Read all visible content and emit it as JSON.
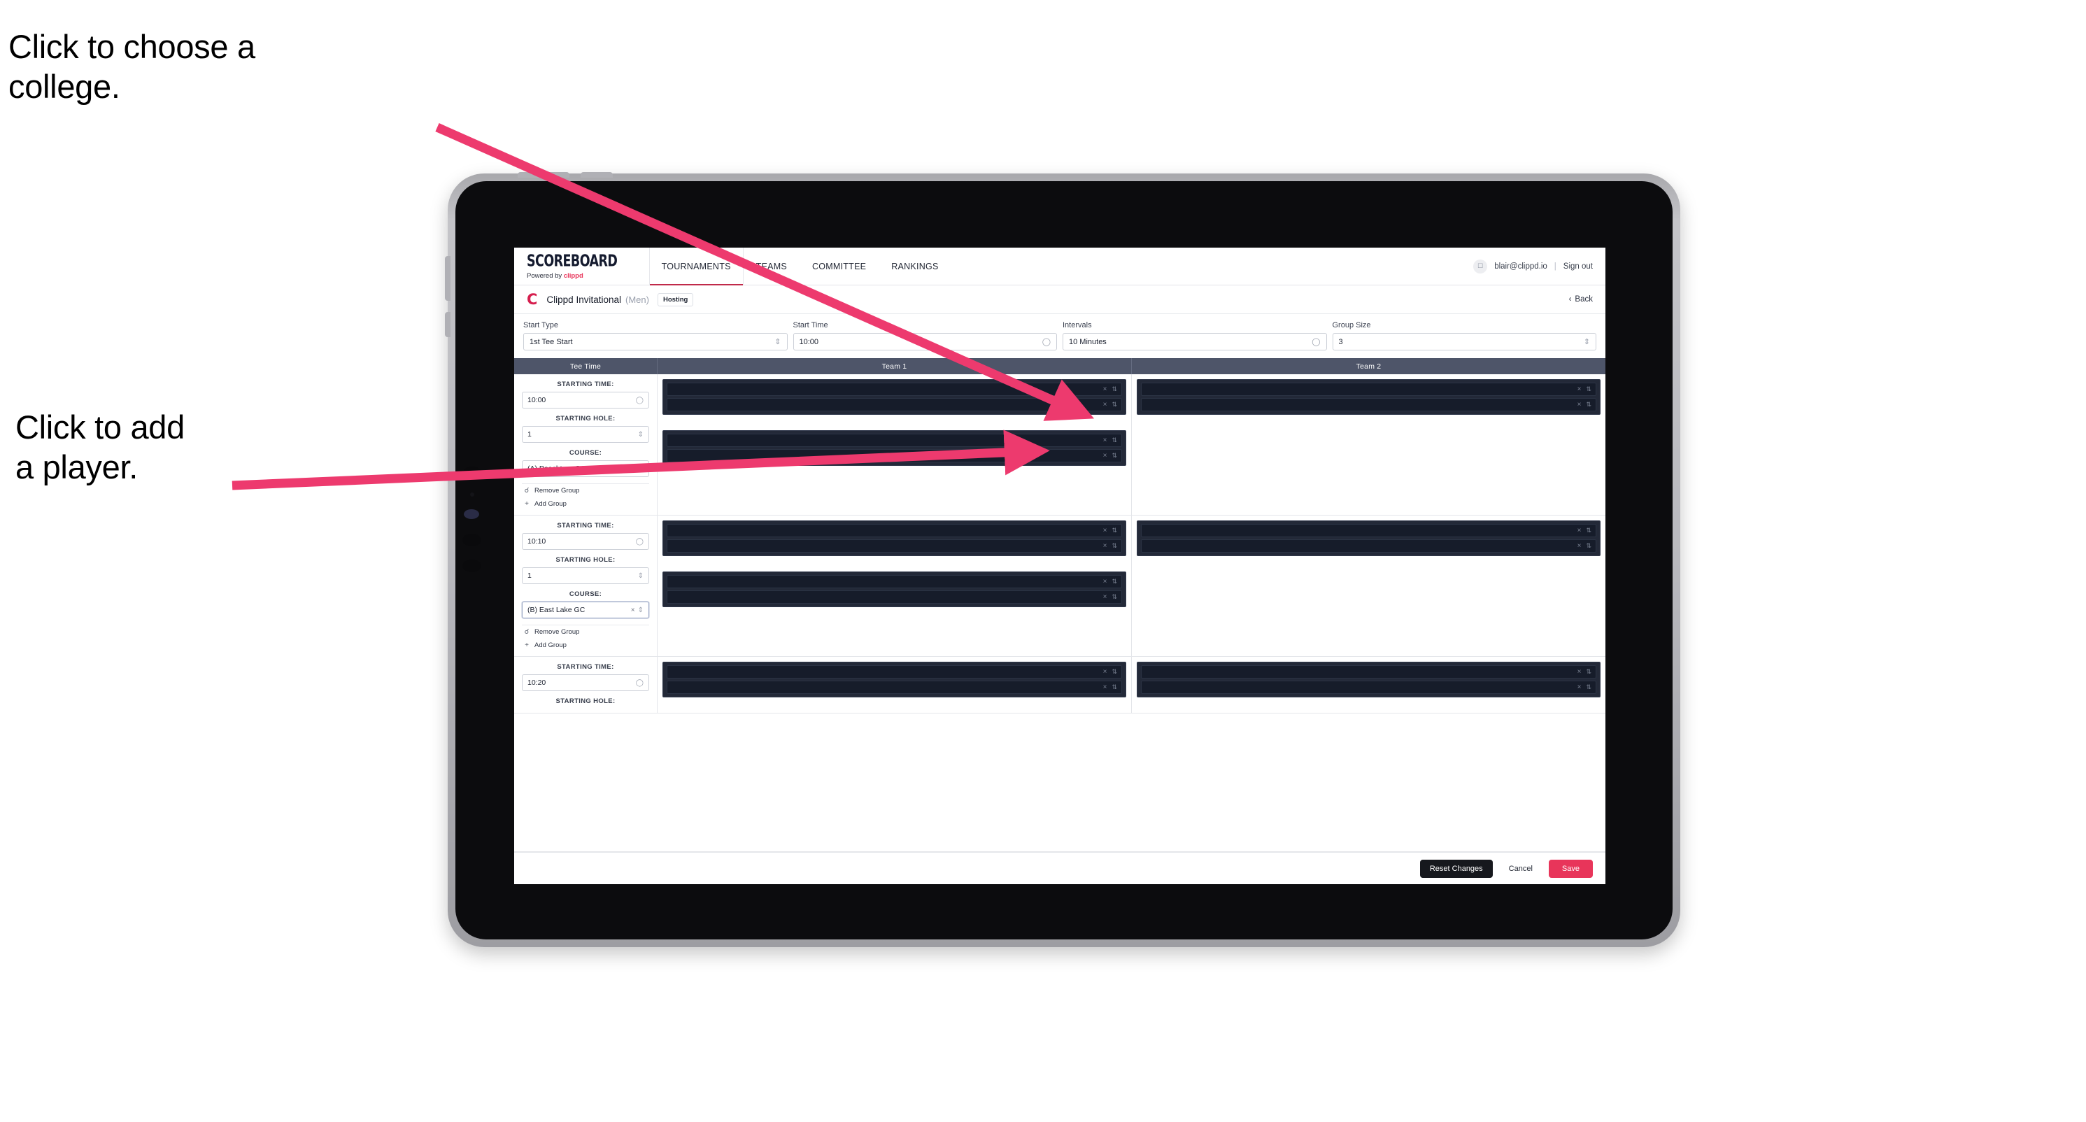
{
  "annotations": {
    "choose_college": "Click to choose a\ncollege.",
    "add_player": "Click to add\na player."
  },
  "app": {
    "navbar": {
      "brand_main": "SCOREBOARD",
      "brand_sub_prefix": "Powered by ",
      "brand_sub_name": "clippd",
      "tabs": [
        {
          "label": "TOURNAMENTS",
          "active": true
        },
        {
          "label": "TEAMS",
          "active": false
        },
        {
          "label": "COMMITTEE",
          "active": false
        },
        {
          "label": "RANKINGS",
          "active": false
        }
      ],
      "avatar_icon": "user-avatar-icon",
      "email": "blair@clippd.io",
      "separator": "|",
      "sign_out": "Sign out"
    },
    "subheader": {
      "club_logo": "C",
      "tournament_name": "Clippd Invitational",
      "gender": "(Men)",
      "badge": "Hosting",
      "back_chevron": "‹",
      "back_label": "Back"
    },
    "controls": [
      {
        "label": "Start Type",
        "value": "1st Tee Start",
        "icon": "stepper-icon"
      },
      {
        "label": "Start Time",
        "value": "10:00",
        "icon": "clock-icon"
      },
      {
        "label": "Intervals",
        "value": "10 Minutes",
        "icon": "clock-icon"
      },
      {
        "label": "Group Size",
        "value": "3",
        "icon": "stepper-icon"
      }
    ],
    "table": {
      "headers": {
        "tee_time": "Tee Time",
        "team1": "Team 1",
        "team2": "Team 2"
      },
      "field_labels": {
        "starting_time": "STARTING TIME:",
        "starting_hole": "STARTING HOLE:",
        "course": "COURSE:"
      },
      "group_actions": {
        "remove": "Remove Group",
        "add": "Add Group",
        "remove_icon": "trash-icon",
        "add_icon": "plus-icon"
      },
      "slot_icons": {
        "clear": "×",
        "stepper": "⇅"
      },
      "rows": [
        {
          "starting_time": "10:00",
          "starting_hole": "1",
          "course": "(A) Peachtree GC",
          "course_focused": false,
          "team1_groups": [
            {
              "slots": 2
            },
            {
              "slots": 2
            }
          ],
          "team2_groups": [
            {
              "slots": 2
            }
          ]
        },
        {
          "starting_time": "10:10",
          "starting_hole": "1",
          "course": "(B) East Lake GC",
          "course_focused": true,
          "team1_groups": [
            {
              "slots": 2
            },
            {
              "slots": 2
            }
          ],
          "team2_groups": [
            {
              "slots": 2
            }
          ]
        },
        {
          "starting_time": "10:20",
          "starting_hole": "",
          "course": "",
          "course_focused": false,
          "team1_groups": [
            {
              "slots": 2
            }
          ],
          "team2_groups": [
            {
              "slots": 2
            }
          ]
        }
      ]
    },
    "footer": {
      "reset": "Reset Changes",
      "cancel": "Cancel",
      "save": "Save"
    }
  },
  "colors": {
    "accent_pink": "#e8355a",
    "brand_red": "#d61f4e",
    "header_slate": "#4e5569",
    "slot_dark": "#161c2a",
    "group_dark": "#232938",
    "annotation_arrow": "#ed3a6e"
  }
}
